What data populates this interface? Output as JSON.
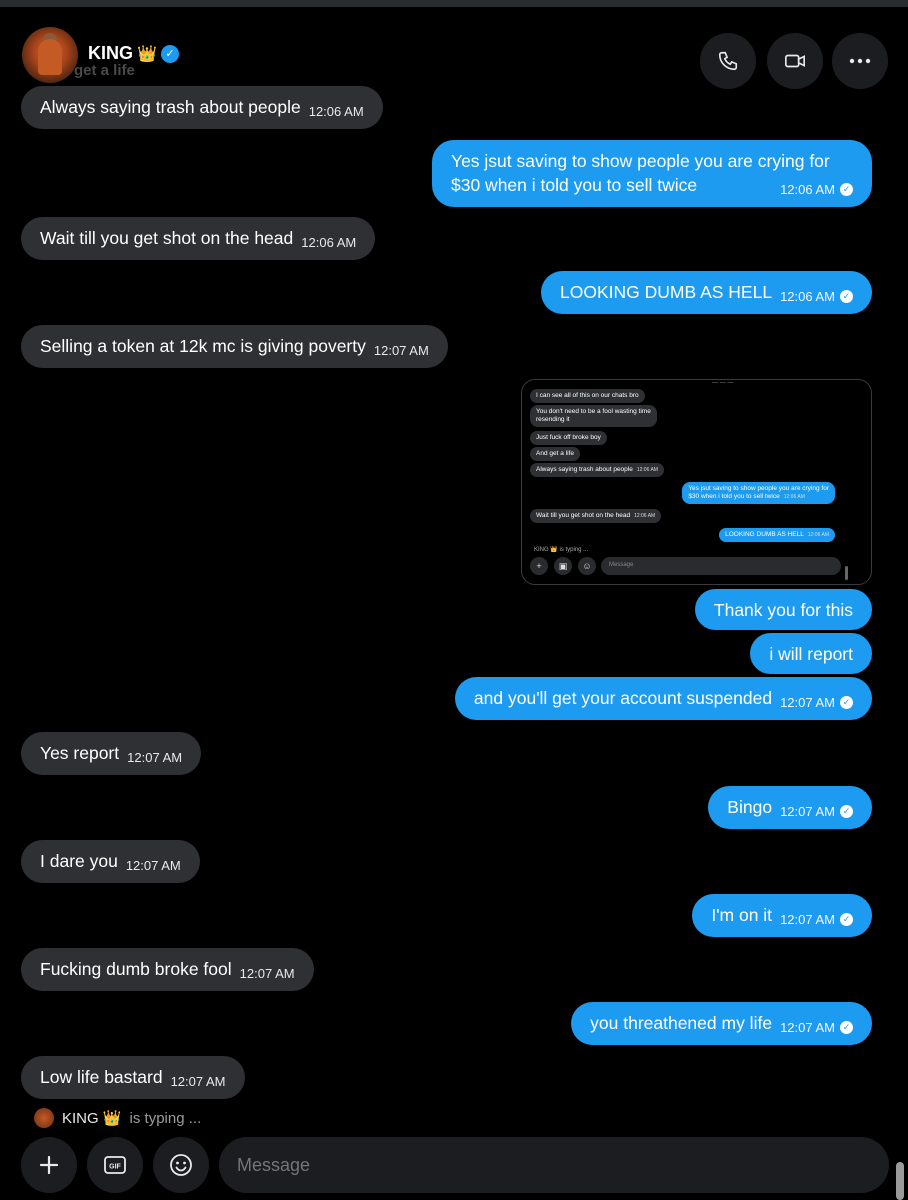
{
  "header": {
    "name": "KING",
    "crown": "👑",
    "ghost": "get a life"
  },
  "messages": [
    {
      "dir": "in",
      "text": "Always saying trash about people",
      "time": "12:06 AM"
    },
    {
      "dir": "out",
      "line1": "Yes jsut saving to show people you are crying for",
      "line2": "$30 when i told you to sell twice",
      "time": "12:06 AM"
    },
    {
      "dir": "in",
      "text": "Wait till you get shot on the head",
      "time": "12:06 AM"
    },
    {
      "dir": "out",
      "text": "LOOKING DUMB AS HELL",
      "time": "12:06 AM"
    },
    {
      "dir": "in",
      "text": "Selling a token at 12k mc is giving poverty",
      "time": "12:07 AM"
    },
    {
      "dir": "out",
      "text": "Thank you for this"
    },
    {
      "dir": "out",
      "text": "i will report"
    },
    {
      "dir": "out",
      "text": "and you'll get your account suspended",
      "time": "12:07 AM"
    },
    {
      "dir": "in",
      "text": "Yes report",
      "time": "12:07 AM"
    },
    {
      "dir": "out",
      "text": "Bingo",
      "time": "12:07 AM"
    },
    {
      "dir": "in",
      "text": "I dare you",
      "time": "12:07 AM"
    },
    {
      "dir": "out",
      "text": "I'm on it",
      "time": "12:07 AM"
    },
    {
      "dir": "in",
      "text": "Fucking dumb broke fool",
      "time": "12:07 AM"
    },
    {
      "dir": "out",
      "text": "you threathened my life",
      "time": "12:07 AM"
    },
    {
      "dir": "in",
      "text": "Low life bastard",
      "time": "12:07 AM"
    }
  ],
  "screenshot": {
    "messages": [
      {
        "text": "I can see all of this on our chats bro"
      },
      {
        "text1": "You don't need to be a fool wasting time",
        "text2": "resending it"
      },
      {
        "text": "Just fuck off broke boy"
      },
      {
        "text": "And get a life"
      },
      {
        "text": "Always saying trash about people",
        "time": "12:06 AM"
      },
      {
        "text1": "Yes jsut saving to show people you are crying for",
        "text2": "$30 when i told you to sell twice",
        "time": "12:06 AM"
      },
      {
        "text": "Wait till you get shot on the head",
        "time": "12:06 AM"
      },
      {
        "text": "LOOKING DUMB AS HELL",
        "time": "12:06 AM"
      }
    ],
    "typing": "KING 👑 is typing ...",
    "placeholder": "Message"
  },
  "typing": {
    "name": "KING",
    "crown": "👑",
    "status": "is typing ..."
  },
  "composer": {
    "placeholder": "Message",
    "gif_label": "GIF"
  },
  "icons": {
    "call": "phone-icon",
    "video": "video-icon",
    "more": "more-icon",
    "add": "plus-icon",
    "gif": "gif-icon",
    "emoji": "emoji-icon"
  },
  "colors": {
    "accent": "#1d9bf0",
    "incoming": "#2f3033",
    "background": "#000000"
  }
}
